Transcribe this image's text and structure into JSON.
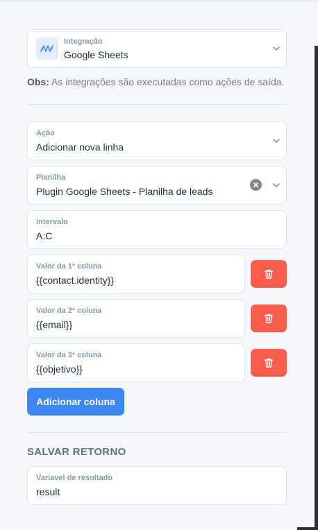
{
  "integration": {
    "label": "Integração",
    "value": "Google Sheets",
    "icon": "sheets-plugin-icon"
  },
  "obs": {
    "prefix": "Obs:",
    "text": " As integrações são executadas como ações de saída."
  },
  "action": {
    "label": "Ação",
    "value": "Adicionar nova linha"
  },
  "spreadsheet": {
    "label": "Planilha",
    "value": "Plugin Google Sheets - Planilha de leads"
  },
  "range": {
    "label": "Intervalo",
    "value": "A:C"
  },
  "columns": [
    {
      "label": "Valor da 1ª coluna",
      "value": "{{contact.identity}}"
    },
    {
      "label": "Valor da 2ª coluna",
      "value": "{{email}}"
    },
    {
      "label": "Valor da 3ª coluna",
      "value": "{{objetivo}}"
    }
  ],
  "add_column_label": "Adicionar coluna",
  "save_return": {
    "title": "SALVAR RETORNO",
    "label": "Variavel de resultado",
    "value": "result"
  },
  "colors": {
    "primary": "#3b86f0",
    "danger": "#fb5d4d",
    "background": "#f5f7fa"
  }
}
